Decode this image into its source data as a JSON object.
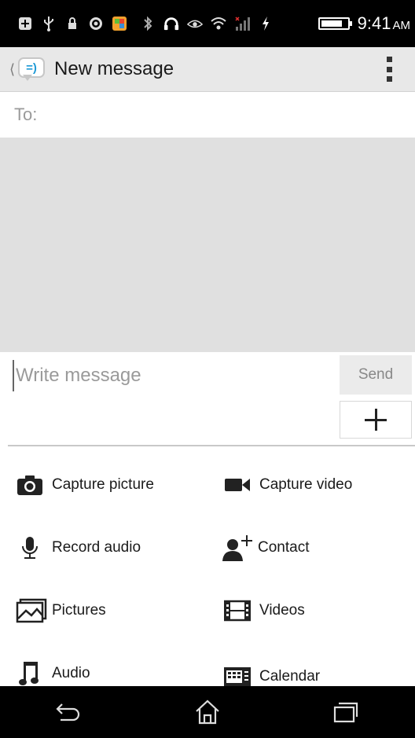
{
  "status_bar": {
    "time": "9:41",
    "ampm": "AM",
    "battery_level": 0.85,
    "icons": [
      "add-icon",
      "usb-icon",
      "lock-icon",
      "fm-icon",
      "gallery-icon",
      "bluetooth-icon",
      "headphones-icon",
      "eye-icon",
      "wifi-icon",
      "signal-icon",
      "charging-icon"
    ]
  },
  "action_bar": {
    "back_glyph": "⟨",
    "app_icon_glyph": "=)",
    "title": "New message"
  },
  "to_field": {
    "label": "To:"
  },
  "compose": {
    "placeholder": "Write message",
    "send_label": "Send"
  },
  "attachments": [
    {
      "label": "Capture picture",
      "icon": "camera-icon"
    },
    {
      "label": "Capture video",
      "icon": "video-camera-icon"
    },
    {
      "label": "Record audio",
      "icon": "microphone-icon"
    },
    {
      "label": "Contact",
      "icon": "add-contact-icon"
    },
    {
      "label": "Pictures",
      "icon": "pictures-icon"
    },
    {
      "label": "Videos",
      "icon": "film-icon"
    },
    {
      "label": "Audio",
      "icon": "music-note-icon"
    },
    {
      "label": "Calendar",
      "icon": "calendar-icon"
    }
  ]
}
